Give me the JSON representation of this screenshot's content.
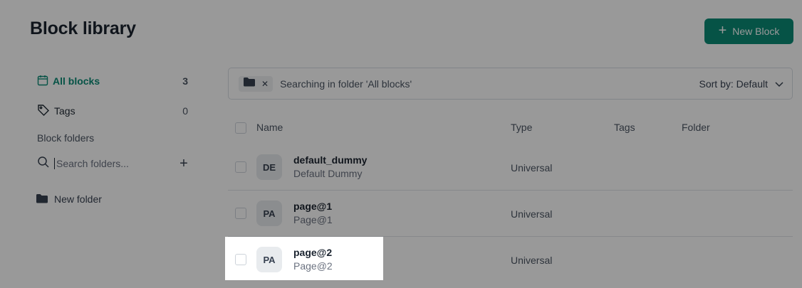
{
  "header": {
    "title": "Block library",
    "new_block_label": "New Block"
  },
  "sidebar": {
    "all_blocks": {
      "label": "All blocks",
      "count": "3"
    },
    "tags": {
      "label": "Tags",
      "count": "0"
    },
    "folders_heading": "Block folders",
    "folder_search_placeholder": "Search folders...",
    "folders": [
      {
        "label": "New folder"
      }
    ]
  },
  "search": {
    "chip_icon": "folder-icon",
    "text": "Searching in folder 'All blocks'",
    "sort_label": "Sort by: Default"
  },
  "table": {
    "columns": {
      "name": "Name",
      "type": "Type",
      "tags": "Tags",
      "folder": "Folder"
    },
    "rows": [
      {
        "initials": "DE",
        "name": "default_dummy",
        "subtitle": "Default Dummy",
        "type": "Universal"
      },
      {
        "initials": "PA",
        "name": "page@1",
        "subtitle": "Page@1",
        "type": "Universal"
      },
      {
        "initials": "PA",
        "name": "page@2",
        "subtitle": "Page@2",
        "type": "Universal"
      }
    ]
  },
  "colors": {
    "accent": "#0a8a75",
    "overlay": "rgba(0,0,0,0.40)"
  }
}
